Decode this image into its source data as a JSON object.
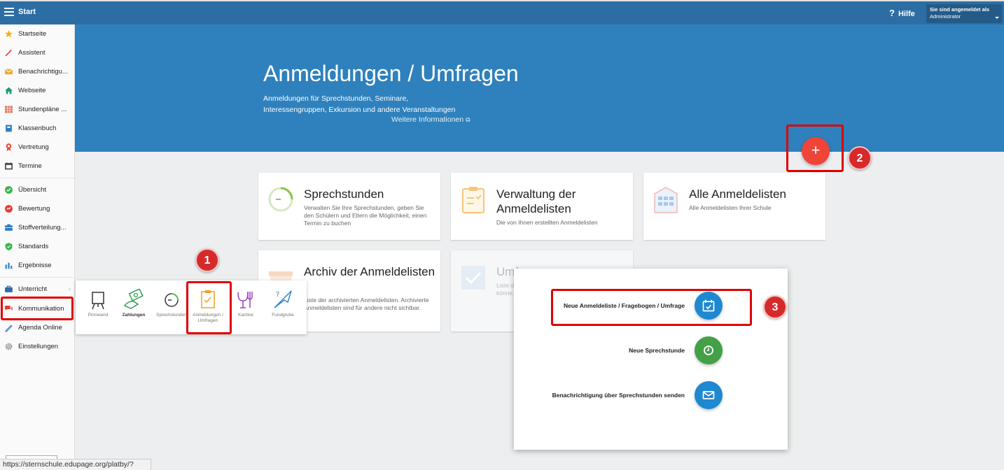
{
  "topbar": {
    "start_label": "Start",
    "help_label": "Hilfe",
    "help_icon": "?",
    "user_line1": "Sie sind angemeldet als",
    "user_line2": "Administrator"
  },
  "sidebar": {
    "items": [
      {
        "label": "Startseite",
        "icon": "star-icon"
      },
      {
        "label": "Assistent",
        "icon": "wand-icon"
      },
      {
        "label": "Benachrichtigu...",
        "icon": "envelope-icon"
      },
      {
        "label": "Webseite",
        "icon": "home-icon"
      },
      {
        "label": "Stundenpläne ...",
        "icon": "timetable-icon"
      },
      {
        "label": "Klassenbuch",
        "icon": "book-icon"
      },
      {
        "label": "Vertretung",
        "icon": "substitute-icon"
      },
      {
        "label": "Termine",
        "icon": "calendar-icon"
      },
      {
        "label": "Übersicht",
        "icon": "check-circle-icon"
      },
      {
        "label": "Bewertung",
        "icon": "grade-icon"
      },
      {
        "label": "Stoffverteilung...",
        "icon": "curriculum-icon"
      },
      {
        "label": "Standards",
        "icon": "shield-icon"
      },
      {
        "label": "Ergebnisse",
        "icon": "bar-chart-icon"
      },
      {
        "label": "Unterricht",
        "icon": "briefcase-icon"
      },
      {
        "label": "Kommunikation",
        "icon": "chat-icon"
      },
      {
        "label": "Agenda Online",
        "icon": "pen-icon"
      },
      {
        "label": "Einstellungen",
        "icon": "gear-icon"
      }
    ]
  },
  "hero": {
    "title": "Anmeldungen / Umfragen",
    "subtitle_line1": "Anmeldungen für Sprechstunden, Seminare,",
    "subtitle_line2": "Interessengruppen, Exkursion und andere Veranstaltungen",
    "more_link": "Weitere Informationen"
  },
  "fab": {
    "label": "+"
  },
  "badges": {
    "one": "1",
    "two": "2",
    "three": "3"
  },
  "cards": [
    {
      "title": "Sprechstunden",
      "desc": "Verwalten Sie Ihre Sprechstunden, geben Sie den Schülern und Eltern die Möglichkeit, einen Termin zu buchen"
    },
    {
      "title": "Verwaltung der Anmeldelisten",
      "desc": "Die von Ihnen erstellten Anmeldelisten"
    },
    {
      "title": "Alle Anmeldelisten",
      "desc": "Alle Anmeldelisten Ihrer Schule"
    },
    {
      "title": "Archiv der Anmeldelisten",
      "desc": "Liste der archivierten Anmeldelisten. Archivierte Anmeldelisten sind für andere nicht sichtbar."
    },
    {
      "title": "Umfragen",
      "desc": "Liste d... könne..."
    }
  ],
  "popup": {
    "items": [
      {
        "label": "Pinnwand"
      },
      {
        "label": "Zahlungen"
      },
      {
        "label": "Sprechstunden"
      },
      {
        "label": "Anmeldungen / Umfragen"
      },
      {
        "label": "Kantine"
      },
      {
        "label": "Fundgrube"
      }
    ]
  },
  "action_menu": {
    "items": [
      {
        "label": "Neue Anmeldeliste / Fragebogen / Umfrage",
        "color": "#1e88d0"
      },
      {
        "label": "Neue Sprechstunde",
        "color": "#43a047"
      },
      {
        "label": "Benachrichtigung über Sprechstunden senden",
        "color": "#1e88d0"
      }
    ]
  },
  "statusbar": {
    "url": "https://sternschule.edupage.org/platby/?"
  },
  "colors": {
    "topbar": "#2c6ea4",
    "hero": "#2e81bd",
    "fab": "#ef4438",
    "highlight": "#e00000"
  }
}
